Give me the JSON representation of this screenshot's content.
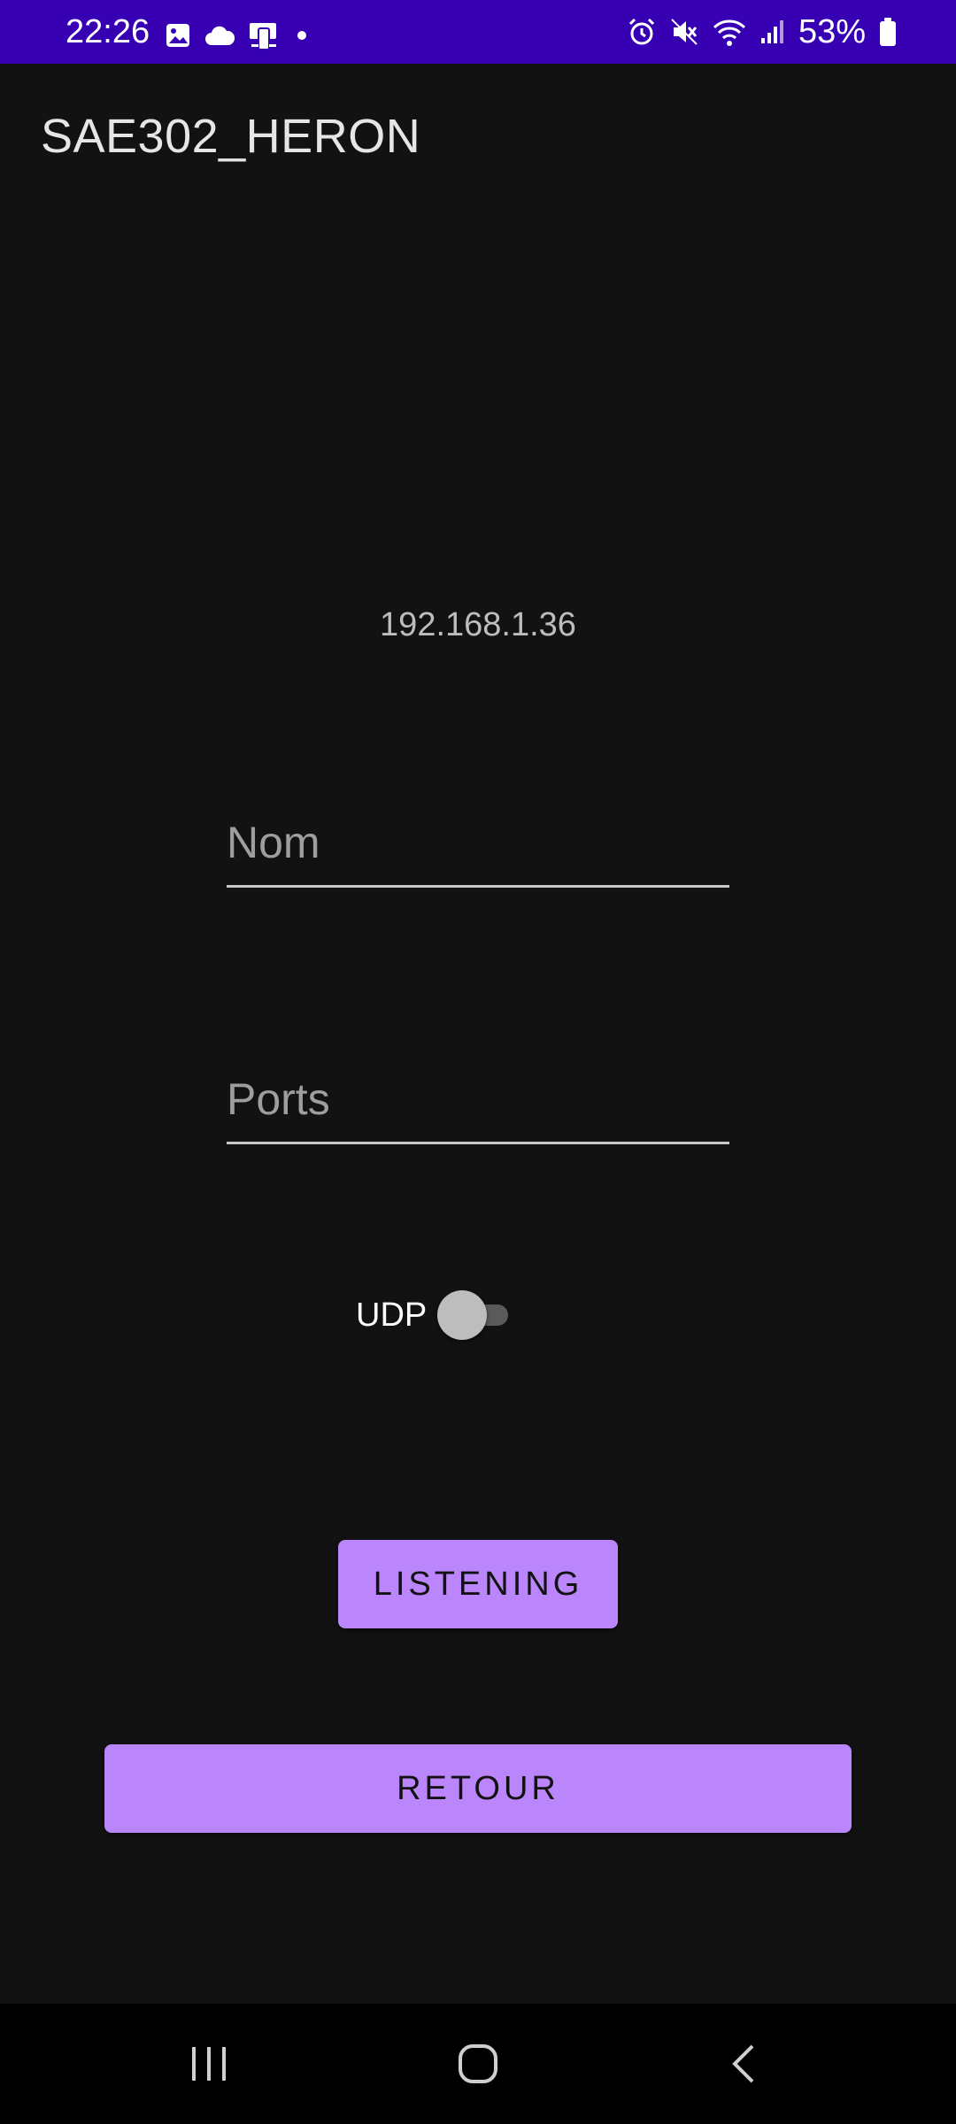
{
  "status_bar": {
    "time": "22:26",
    "battery": "53%",
    "left_icons": [
      "image-icon",
      "cloud-icon",
      "device-icon",
      "dot-icon"
    ],
    "right_icons": [
      "alarm-icon",
      "mute-icon",
      "wifi-icon",
      "signal-icon",
      "battery-icon"
    ],
    "background": "#3700b3"
  },
  "app_bar": {
    "title": "SAE302_HERON"
  },
  "main": {
    "ip_address": "192.168.1.36",
    "nom_field": {
      "placeholder": "Nom",
      "value": ""
    },
    "ports_field": {
      "placeholder": "Ports",
      "value": ""
    },
    "udp_switch": {
      "label": "UDP",
      "checked": false
    },
    "listening_button": "LISTENING",
    "retour_button": "RETOUR",
    "accent_color": "#bb86fc"
  },
  "nav_bar": {
    "buttons": [
      "recents-icon",
      "home-icon",
      "back-icon"
    ]
  }
}
